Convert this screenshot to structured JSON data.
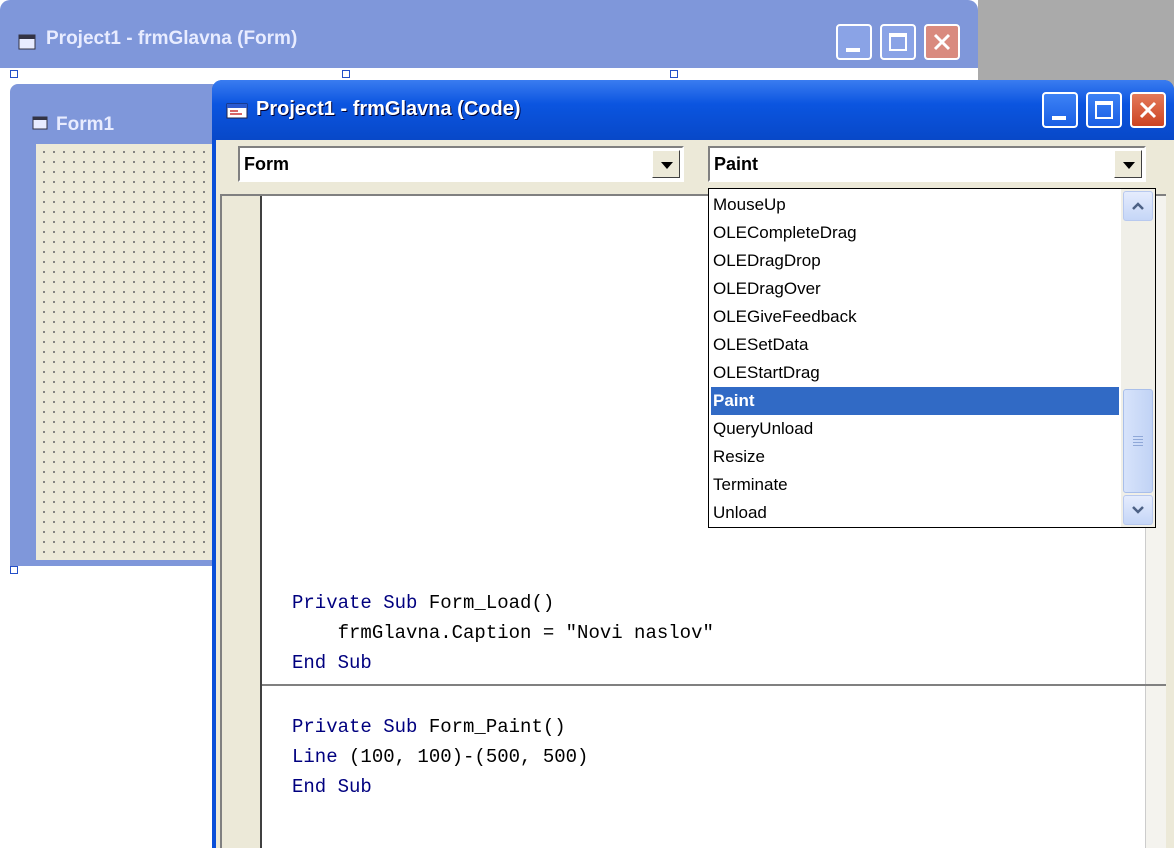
{
  "form_window": {
    "title": "Project1 - frmGlavna (Form)"
  },
  "form1": {
    "title": "Form1"
  },
  "code_window": {
    "title": "Project1 - frmGlavna (Code)",
    "object_combo": "Form",
    "procedure_combo": "Paint"
  },
  "dropdown": {
    "items": [
      "MouseUp",
      "OLECompleteDrag",
      "OLEDragDrop",
      "OLEDragOver",
      "OLEGiveFeedback",
      "OLESetData",
      "OLEStartDrag",
      "Paint",
      "QueryUnload",
      "Resize",
      "Terminate",
      "Unload"
    ],
    "selected": "Paint"
  },
  "code": {
    "load": {
      "line1_kw": "Private Sub",
      "line1_rest": " Form_Load()",
      "line2": "    frmGlavna.Caption = \"Novi naslov\"",
      "line3": "End Sub"
    },
    "paint": {
      "line1_kw": "Private Sub",
      "line1_rest": " Form_Paint()",
      "line2": "Line (100, 100)-(500, 500)",
      "line3": "End Sub"
    }
  }
}
